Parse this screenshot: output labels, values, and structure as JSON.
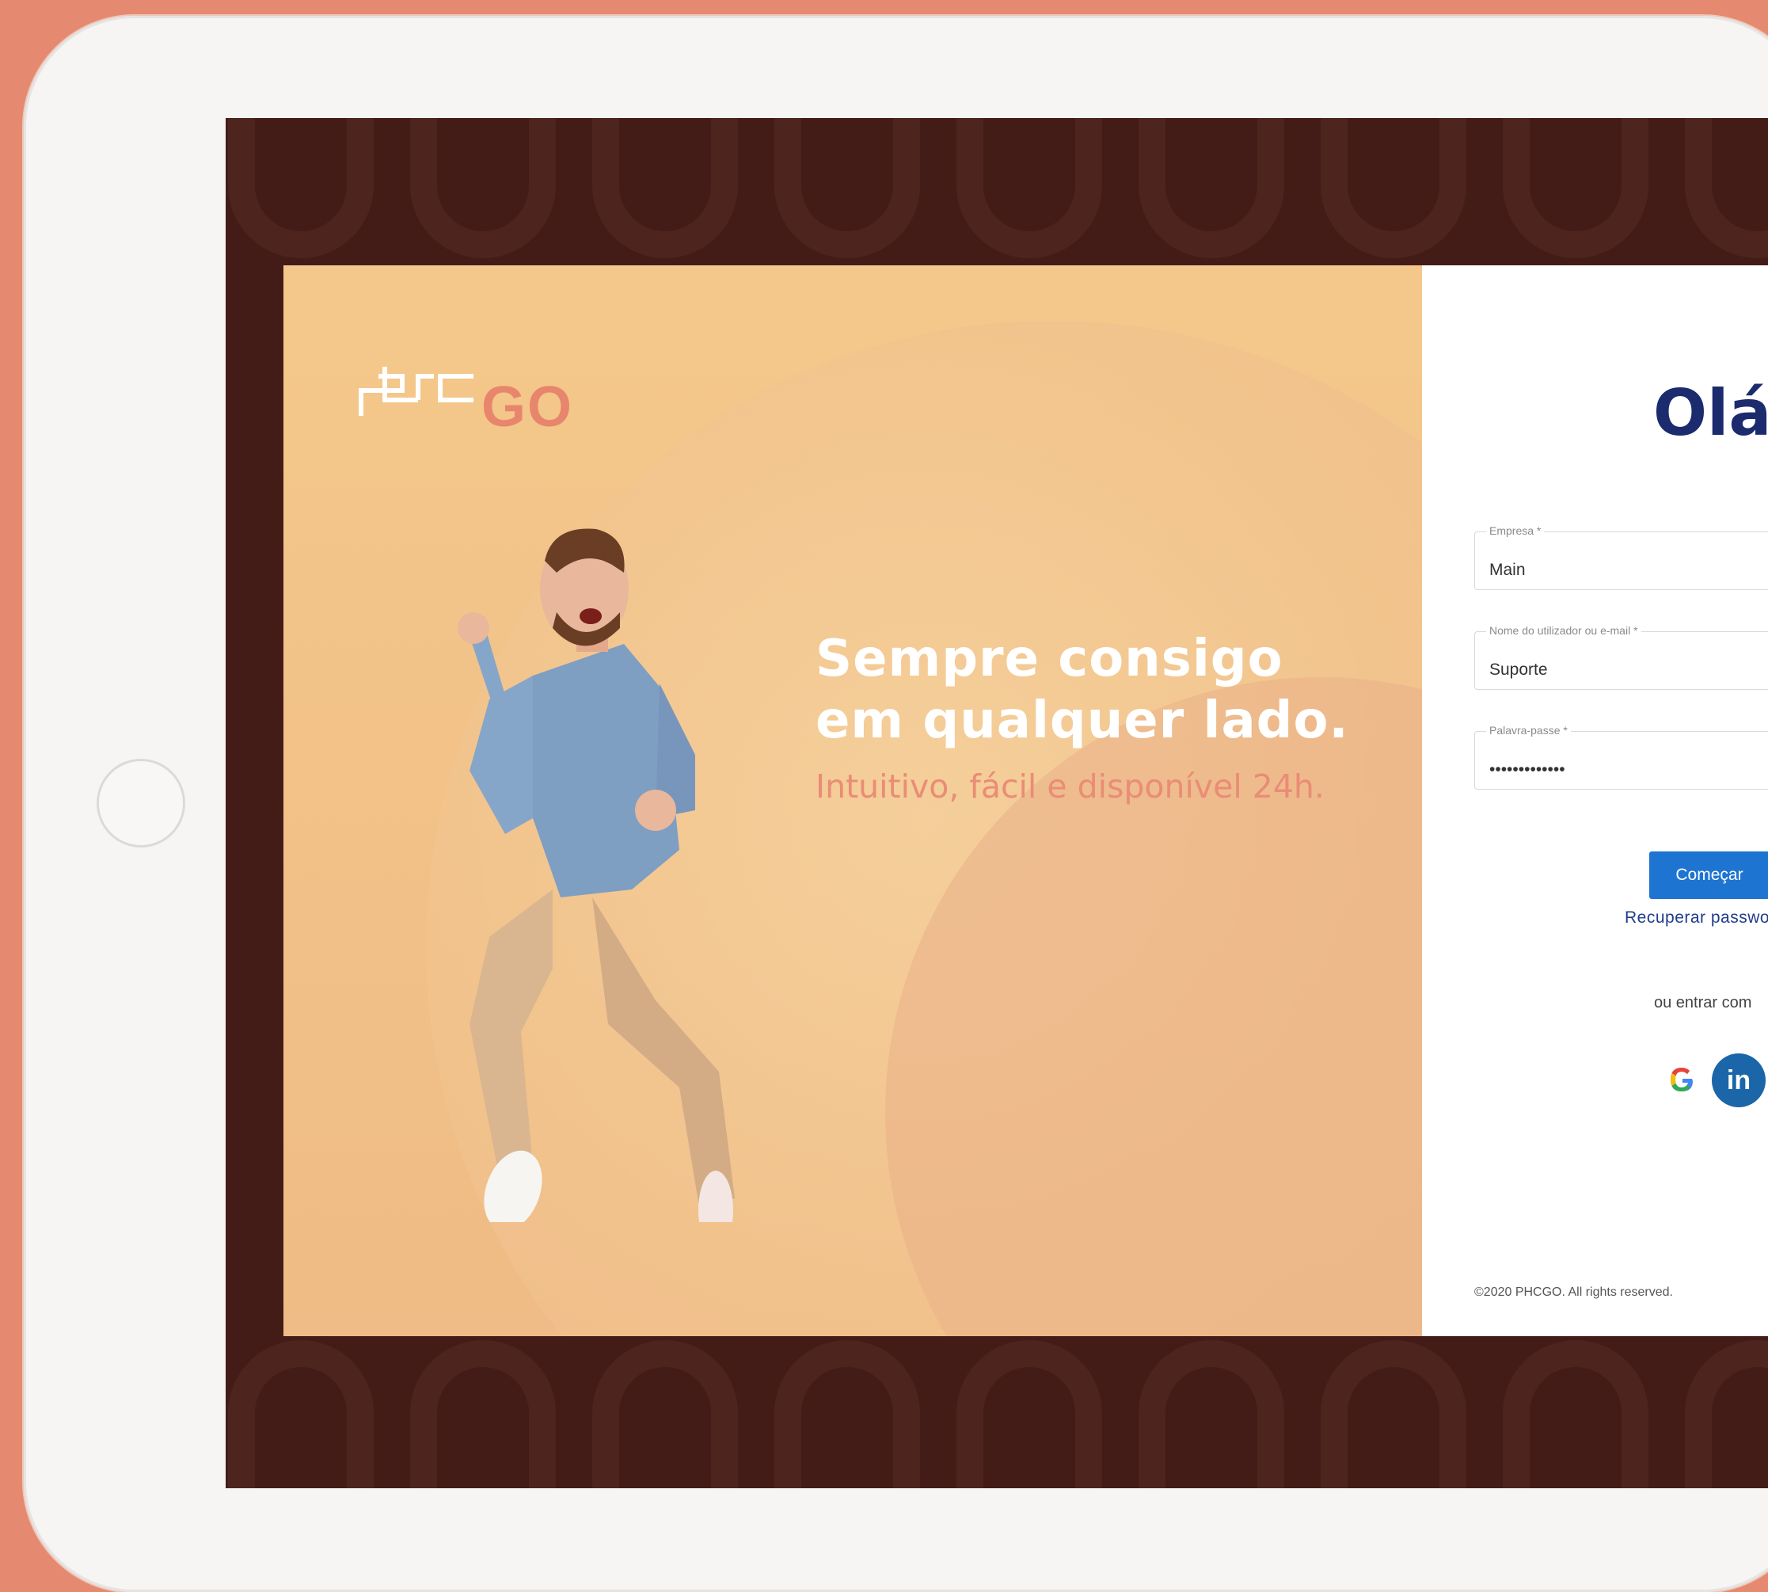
{
  "brand": {
    "logo_text": "phc",
    "logo_suffix": "GO"
  },
  "hero": {
    "headline_line1": "Sempre consigo",
    "headline_line2": "em qualquer lado.",
    "tagline": "Intuitivo, fácil e disponível 24h."
  },
  "login": {
    "greeting": "Olá",
    "fields": [
      {
        "label": "Empresa *",
        "value": "Main"
      },
      {
        "label": "Nome do utilizador ou e-mail *",
        "value": "Suporte"
      },
      {
        "label": "Palavra-passe *",
        "value": "•••••••••••••"
      }
    ],
    "start_button": "Começar",
    "recover_link": "Recuperar password",
    "alt_login_text": "ou entrar com",
    "google_label": "G",
    "linkedin_label": "in",
    "copyright": "©2020 PHCGO. All rights reserved."
  },
  "colors": {
    "frame_background": "#e58a70",
    "screen_background": "#441c17",
    "hero_background": "#f4c88b",
    "accent": "#ea8c76",
    "primary_button": "#1e74d1",
    "greeting_text": "#1c2b6e",
    "linkedin": "#1a66a8"
  },
  "icons": [
    "home-button-icon",
    "google-icon",
    "linkedin-icon"
  ]
}
